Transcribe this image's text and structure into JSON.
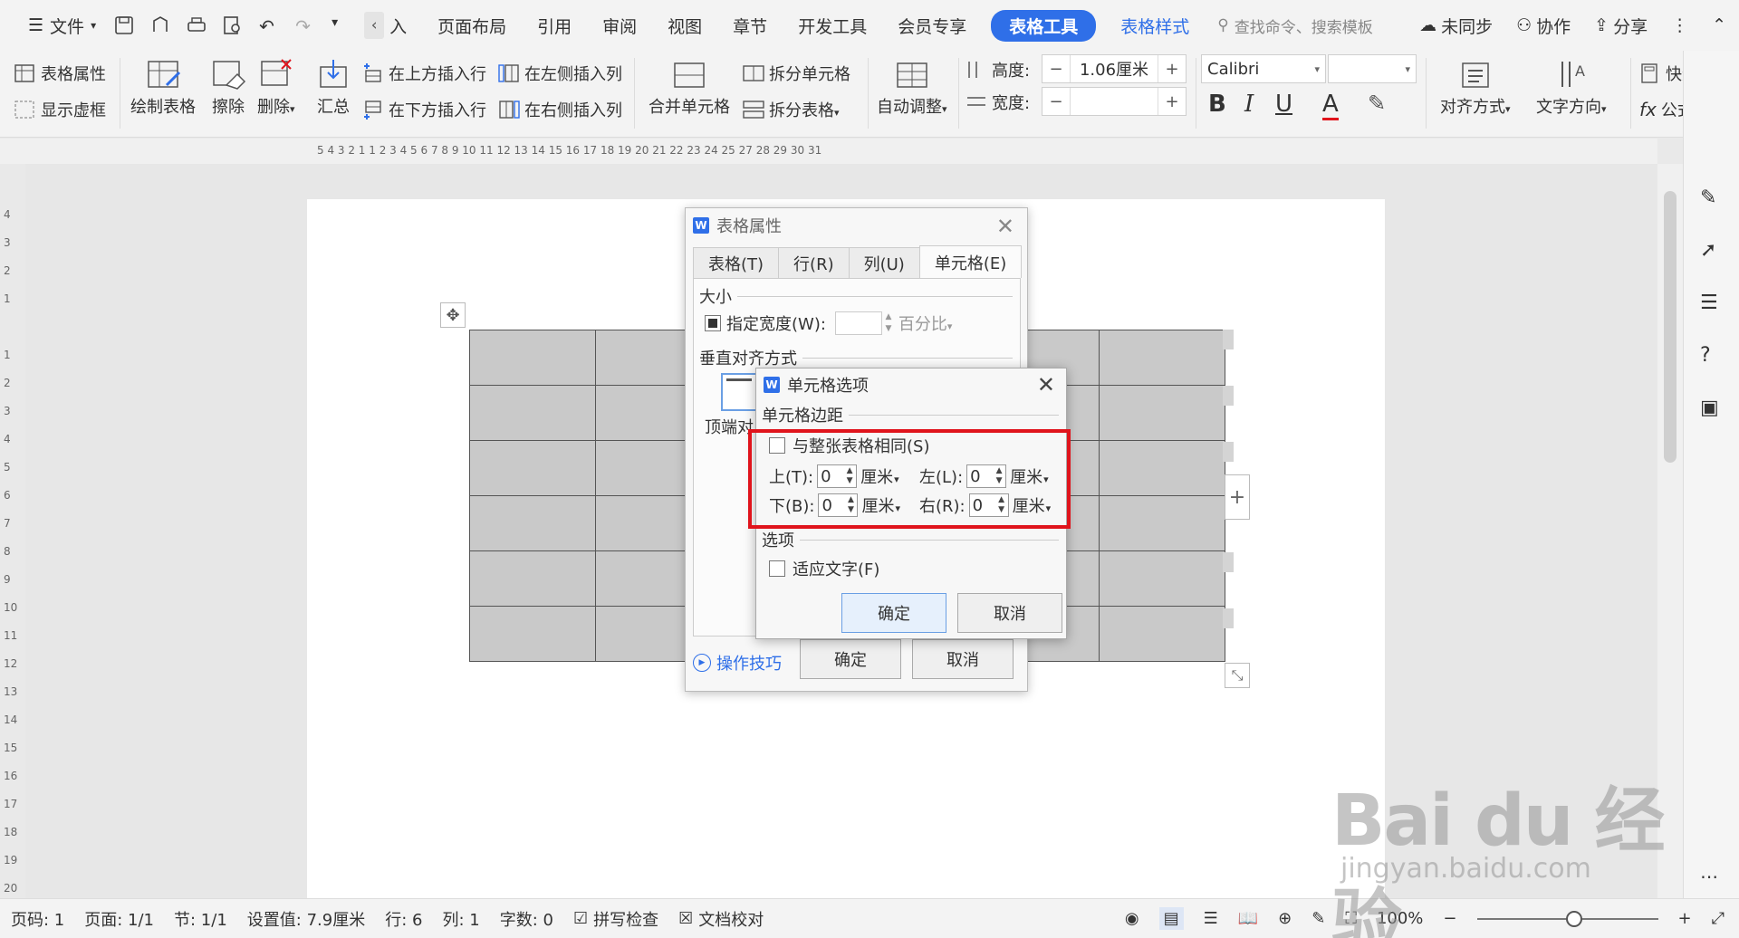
{
  "menubar": {
    "file_label": "文件",
    "insert_label": "入",
    "items": [
      "页面布局",
      "引用",
      "审阅",
      "视图",
      "章节",
      "开发工具",
      "会员专享"
    ],
    "active_tab": "表格工具",
    "style_tab": "表格样式",
    "search_placeholder": "查找命令、搜索模板",
    "sync_label": "未同步",
    "collab_label": "协作",
    "share_label": "分享"
  },
  "ribbon": {
    "table_props": "表格属性",
    "show_grid": "显示虚框",
    "draw_table": "绘制表格",
    "erase": "擦除",
    "delete": "删除",
    "summary": "汇总",
    "insert_above": "在上方插入行",
    "insert_below": "在下方插入行",
    "insert_left": "在左侧插入列",
    "insert_right": "在右侧插入列",
    "merge_cells": "合并单元格",
    "split_cells": "拆分单元格",
    "split_table": "拆分表格",
    "auto_fit": "自动调整",
    "height_label": "高度:",
    "height_value": "1.06厘米",
    "width_label": "宽度:",
    "width_value": "",
    "font_name": "Calibri",
    "font_size": "",
    "align": "对齐方式",
    "text_dir": "文字方向",
    "quick_calc": "快速计",
    "formula": "公式"
  },
  "ruler": {
    "h_ticks": "5   4   3   2   1         1   2   3   4   5   6   7   8   9   10   11   12   13   14   15   16   17   18   19   20   21   22   23   24   25        27   28   29   30   31",
    "v_ticks": [
      "4",
      "3",
      "2",
      "1",
      "",
      "1",
      "2",
      "3",
      "4",
      "5",
      "6",
      "7",
      "8",
      "9",
      "10",
      "11",
      "12",
      "13",
      "14",
      "15",
      "16",
      "17",
      "18",
      "19",
      "20"
    ]
  },
  "dialog_table_props": {
    "title": "表格属性",
    "tabs": [
      "表格(T)",
      "行(R)",
      "列(U)",
      "单元格(E)"
    ],
    "group_size": "大小",
    "specify_width": "指定宽度(W):",
    "width_unit": "百分比",
    "group_valign": "垂直对齐方式",
    "top_label": "顶端对",
    "tips": "操作技巧",
    "ok": "确定",
    "cancel": "取消"
  },
  "dialog_cell_options": {
    "title": "单元格选项",
    "group_margin": "单元格边距",
    "same_as_table": "与整张表格相同(S)",
    "top_label": "上(T):",
    "top_value": "0",
    "left_label": "左(L):",
    "left_value": "0",
    "bottom_label": "下(B):",
    "bottom_value": "0",
    "right_label": "右(R):",
    "right_value": "0",
    "unit": "厘米",
    "group_options": "选项",
    "fit_text": "适应文字(F)",
    "ok": "确定",
    "cancel": "取消"
  },
  "statusbar": {
    "page_num": "页码: 1",
    "pages": "页面: 1/1",
    "section": "节: 1/1",
    "setting": "设置值: 7.9厘米",
    "row": "行: 6",
    "col": "列: 1",
    "words": "字数: 0",
    "spell": "拼写检查",
    "proofread": "文档校对",
    "zoom": "100%"
  },
  "watermark": {
    "brand": "Bai du 经验",
    "url": "jingyan.baidu.com"
  },
  "colors": {
    "accent": "#2f6fe8",
    "highlight": "#e0141c"
  }
}
